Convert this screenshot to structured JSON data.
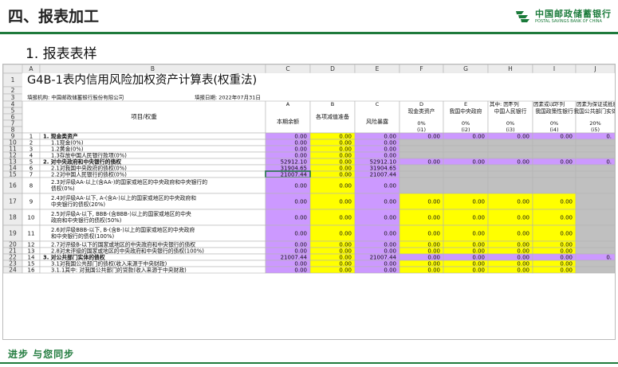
{
  "slide": {
    "title": "四、报表加工",
    "subtitle": "1. 报表表样",
    "brand_cn": "中国邮政储蓄银行",
    "brand_en": "POSTAL SAVINGS BANK OF CHINA",
    "tagline": "进步 与您同步"
  },
  "colors": {
    "green": "#1f7a3c",
    "purple": "#cc99ff",
    "yellow": "#ffff00",
    "gray": "#c0c0c0",
    "header_bg": "#ececec",
    "select_green": "#217346"
  },
  "sheet": {
    "col_letters": [
      "A",
      "B",
      "C",
      "D",
      "E",
      "F",
      "G",
      "H",
      "I",
      "J"
    ],
    "report_title": "G4B-1表内信用风险加权资产计算表(权重法)",
    "filler": "填报机构: 中国邮政储蓄银行股份有限公司",
    "date": "填报日期: 2022年07月31日",
    "header": {
      "item": "项目/权重",
      "letters": [
        "A",
        "B",
        "C",
        "D",
        "E",
        "F",
        "G",
        "H"
      ],
      "col_c": "本期余额",
      "col_d": "各项减值准备",
      "col_e": "风险暴露",
      "row4_f": "其中: 因下列",
      "row4_g": "因素或以下列",
      "row4_h": "因素为保证或抵质押, 可得以风险缓释",
      "col_f": "现金类资产",
      "col_g": "我国中央政府",
      "col_h": "中国人民银行",
      "col_i": "我国政策性银行",
      "col_j": "我国公共部门实体",
      "pct_f": "0%",
      "pct_g": "0%",
      "pct_h": "0%",
      "pct_i": "0%",
      "pct_j": "20%",
      "code_f": "(i1)",
      "code_g": "(i2)",
      "code_h": "(i3)",
      "code_i": "(i4)",
      "code_j": "(i5)"
    },
    "rows": [
      {
        "rn": "9",
        "a": "1",
        "b": "1. 现金类资产",
        "c": "0.00",
        "d": "0.00",
        "e": "0.00",
        "f": "0.00",
        "g": "0.00",
        "h": "0.00",
        "i": "0.00",
        "j": "0."
      },
      {
        "rn": "10",
        "a": "2",
        "b": "1.1现金(0%)",
        "c": "0.00",
        "d": "0.00",
        "e": "0.00"
      },
      {
        "rn": "11",
        "a": "3",
        "b": "1.2黄金(0%)",
        "c": "0.00",
        "d": "0.00",
        "e": "0.00"
      },
      {
        "rn": "12",
        "a": "4",
        "b": "1.3存放中国人民银行款项(0%)",
        "c": "0.00",
        "d": "0.00",
        "e": "0.00"
      },
      {
        "rn": "13",
        "a": "5",
        "b": "2. 对中央政府和中央银行的债权",
        "c": "52912.10",
        "d": "0.00",
        "e": "52912.10",
        "f": "0.00",
        "g": "0.00",
        "h": "0.00",
        "i": "0.00",
        "j": "0."
      },
      {
        "rn": "14",
        "a": "6",
        "b": "2.1对我国中央政府的债权(0%)",
        "c": "31904.65",
        "d": "0.00",
        "e": "31904.65"
      },
      {
        "rn": "15",
        "a": "7",
        "b": "2.2对中国人民银行的债权(0%)",
        "c": "21007.44",
        "d": "0.00",
        "e": "21007.44"
      },
      {
        "rn": "16",
        "a": "8",
        "b": "2.3对评级AA-以上(含AA-)的国家或地区的中央政府和中央银行的债权(0%)",
        "c": "0.00",
        "d": "0.00",
        "e": "0.00"
      },
      {
        "rn": "17",
        "a": "9",
        "b": "2.4对评级AA-以下, A-(含A-)以上的国家或地区的中央政府和中央银行的债权(20%)",
        "c": "0.00",
        "d": "0.00",
        "e": "0.00",
        "f": "0.00",
        "g": "0.00",
        "h": "0.00",
        "i": "0.00"
      },
      {
        "rn": "18",
        "a": "10",
        "b": "2.5对评级A-以下, BBB-(含BBB-)以上的国家或地区的中央政府和中央银行的债权(50%)",
        "c": "0.00",
        "d": "0.00",
        "e": "0.00",
        "f": "0.00",
        "g": "0.00",
        "h": "0.00",
        "i": "0.00"
      },
      {
        "rn": "19",
        "a": "11",
        "b": "2.6对评级BBB-以下, B-(含B-)以上的国家或地区的中央政府和中央银行的债权(100%)",
        "c": "0.00",
        "d": "0.00",
        "e": "0.00",
        "f": "0.00",
        "g": "0.00",
        "h": "0.00",
        "i": "0.00"
      },
      {
        "rn": "20",
        "a": "12",
        "b": "2.7对评级B-以下的国家或地区的中央政府和中央银行的债权",
        "c": "0.00",
        "d": "0.00",
        "e": "0.00",
        "f": "0.00",
        "g": "0.00",
        "h": "0.00",
        "i": "0.00"
      },
      {
        "rn": "21",
        "a": "13",
        "b": "2.8对未评级的国家或地区的中央政府和中央银行的债权(100%)",
        "c": "0.00",
        "d": "0.00",
        "e": "0.00",
        "f": "0.00",
        "g": "0.00",
        "h": "0.00",
        "i": "0.00"
      },
      {
        "rn": "22",
        "a": "14",
        "b": "3. 对公共部门实体的债权",
        "c": "21007.44",
        "d": "0.00",
        "e": "21007.44",
        "f": "0.00",
        "g": "0.00",
        "h": "0.00",
        "i": "0.00",
        "j": "0."
      },
      {
        "rn": "23",
        "a": "15",
        "b": "3.1对我国公共部门的债权(收入来源于中央财政)",
        "c": "0.00",
        "d": "0.00",
        "e": "0.00",
        "f": "0.00",
        "g": "0.00",
        "h": "0.00",
        "i": "0.00"
      },
      {
        "rn": "24",
        "a": "16",
        "b": "3.1.1其中: 对我国公共部门的贷款(收入来源于中央财政)",
        "c": "0.00",
        "d": "0.00",
        "e": "0.00",
        "f": "0.00",
        "g": "0.00",
        "h": "0.00",
        "i": "0.00"
      }
    ]
  }
}
